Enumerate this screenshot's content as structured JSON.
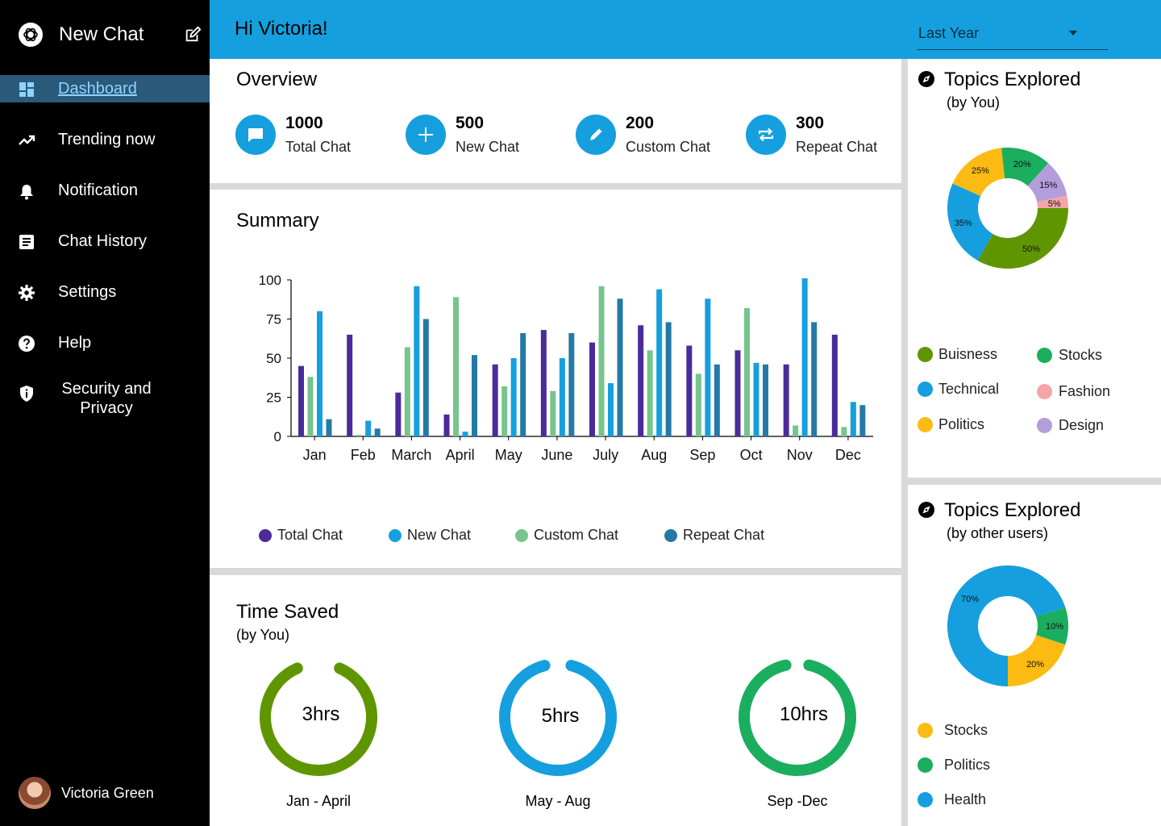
{
  "sidebar": {
    "new_chat_label": "New Chat",
    "items": [
      {
        "label": "Dashboard",
        "icon": "dashboard-icon",
        "active": true
      },
      {
        "label": "Trending now",
        "icon": "trending-icon"
      },
      {
        "label": "Notification",
        "icon": "bell-icon"
      },
      {
        "label": "Chat History",
        "icon": "document-icon"
      },
      {
        "label": "Settings",
        "icon": "gear-icon"
      },
      {
        "label": "Help",
        "icon": "help-icon"
      },
      {
        "label": "Security and Privacy",
        "icon": "shield-icon"
      }
    ],
    "user_name": "Victoria Green"
  },
  "header": {
    "greeting": "Hi Victoria!",
    "period": "Last Year"
  },
  "overview": {
    "title": "Overview",
    "stats": [
      {
        "value": "1000",
        "label": "Total Chat",
        "icon": "chat-bubble-icon"
      },
      {
        "value": "500",
        "label": "New Chat",
        "icon": "plus-icon"
      },
      {
        "value": "200",
        "label": "Custom Chat",
        "icon": "pencil-icon"
      },
      {
        "value": "300",
        "label": "Repeat Chat",
        "icon": "repeat-icon"
      }
    ]
  },
  "summary": {
    "title": "Summary"
  },
  "time_saved": {
    "title": "Time Saved",
    "subtitle": "(by You)",
    "rings": [
      {
        "value": "3hrs",
        "period": "Jan - April",
        "color": "#5f9600",
        "fraction": 0.87
      },
      {
        "value": "5hrs",
        "period": "May - Aug",
        "color": "#159fde",
        "fraction": 0.92
      },
      {
        "value": "10hrs",
        "period": "Sep -Dec",
        "color": "#1aae5e",
        "fraction": 0.93
      }
    ]
  },
  "topics_you": {
    "title": "Topics Explored",
    "subtitle": "(by You)",
    "legend": [
      {
        "label": "Buisness",
        "color": "#5f9600"
      },
      {
        "label": "Stocks",
        "color": "#1aae5e"
      },
      {
        "label": "Technical",
        "color": "#159fde"
      },
      {
        "label": "Fashion",
        "color": "#f4a6a6"
      },
      {
        "label": "Politics",
        "color": "#fbbb12"
      },
      {
        "label": "Design",
        "color": "#b39ddb"
      }
    ]
  },
  "topics_others": {
    "title": "Topics Explored",
    "subtitle": "(by other users)",
    "legend": [
      {
        "label": "Stocks",
        "color": "#fbbb12"
      },
      {
        "label": "Politics",
        "color": "#1aae5e"
      },
      {
        "label": "Health",
        "color": "#159fde"
      }
    ]
  },
  "chart_data": [
    {
      "type": "bar",
      "categories": [
        "Jan",
        "Feb",
        "March",
        "April",
        "May",
        "June",
        "July",
        "Aug",
        "Sep",
        "Oct",
        "Nov",
        "Dec"
      ],
      "ylim": [
        0,
        100
      ],
      "yticks": [
        0,
        25,
        50,
        75,
        100
      ],
      "legend_position": "bottom",
      "series": [
        {
          "name": "Total Chat",
          "color": "#4b2a9b",
          "values": [
            45,
            65,
            28,
            14,
            46,
            68,
            60,
            71,
            58,
            55,
            46,
            65
          ]
        },
        {
          "name": "Custom Chat",
          "color": "#77c48e",
          "values": [
            38,
            1,
            57,
            89,
            32,
            29,
            96,
            55,
            40,
            82,
            7,
            6
          ]
        },
        {
          "name": "New Chat",
          "color": "#159fde",
          "values": [
            80,
            10,
            96,
            3,
            50,
            50,
            34,
            94,
            88,
            47,
            101,
            22
          ]
        },
        {
          "name": "Repeat Chat",
          "color": "#237aa6",
          "values": [
            11,
            5,
            75,
            52,
            66,
            66,
            88,
            73,
            46,
            46,
            73,
            20
          ]
        }
      ],
      "legend_order": [
        "Total Chat",
        "New Chat",
        "Custom Chat",
        "Repeat Chat"
      ]
    },
    {
      "type": "pie",
      "labels": [
        "Buisness",
        "Technical",
        "Politics",
        "Stocks",
        "Design",
        "Fashion"
      ],
      "values": [
        50,
        35,
        25,
        20,
        15,
        5
      ],
      "display": [
        "50%",
        "35%",
        "25%",
        "20%",
        "15%",
        "5%"
      ],
      "colors": [
        "#5f9600",
        "#159fde",
        "#fbbb12",
        "#1aae5e",
        "#b39ddb",
        "#f4a6a6"
      ]
    },
    {
      "type": "pie",
      "labels": [
        "Health",
        "Politics",
        "Stocks"
      ],
      "values": [
        70,
        10,
        20
      ],
      "display": [
        "70%",
        "10%",
        "20%"
      ],
      "colors": [
        "#159fde",
        "#1aae5e",
        "#fbbb12"
      ]
    }
  ]
}
